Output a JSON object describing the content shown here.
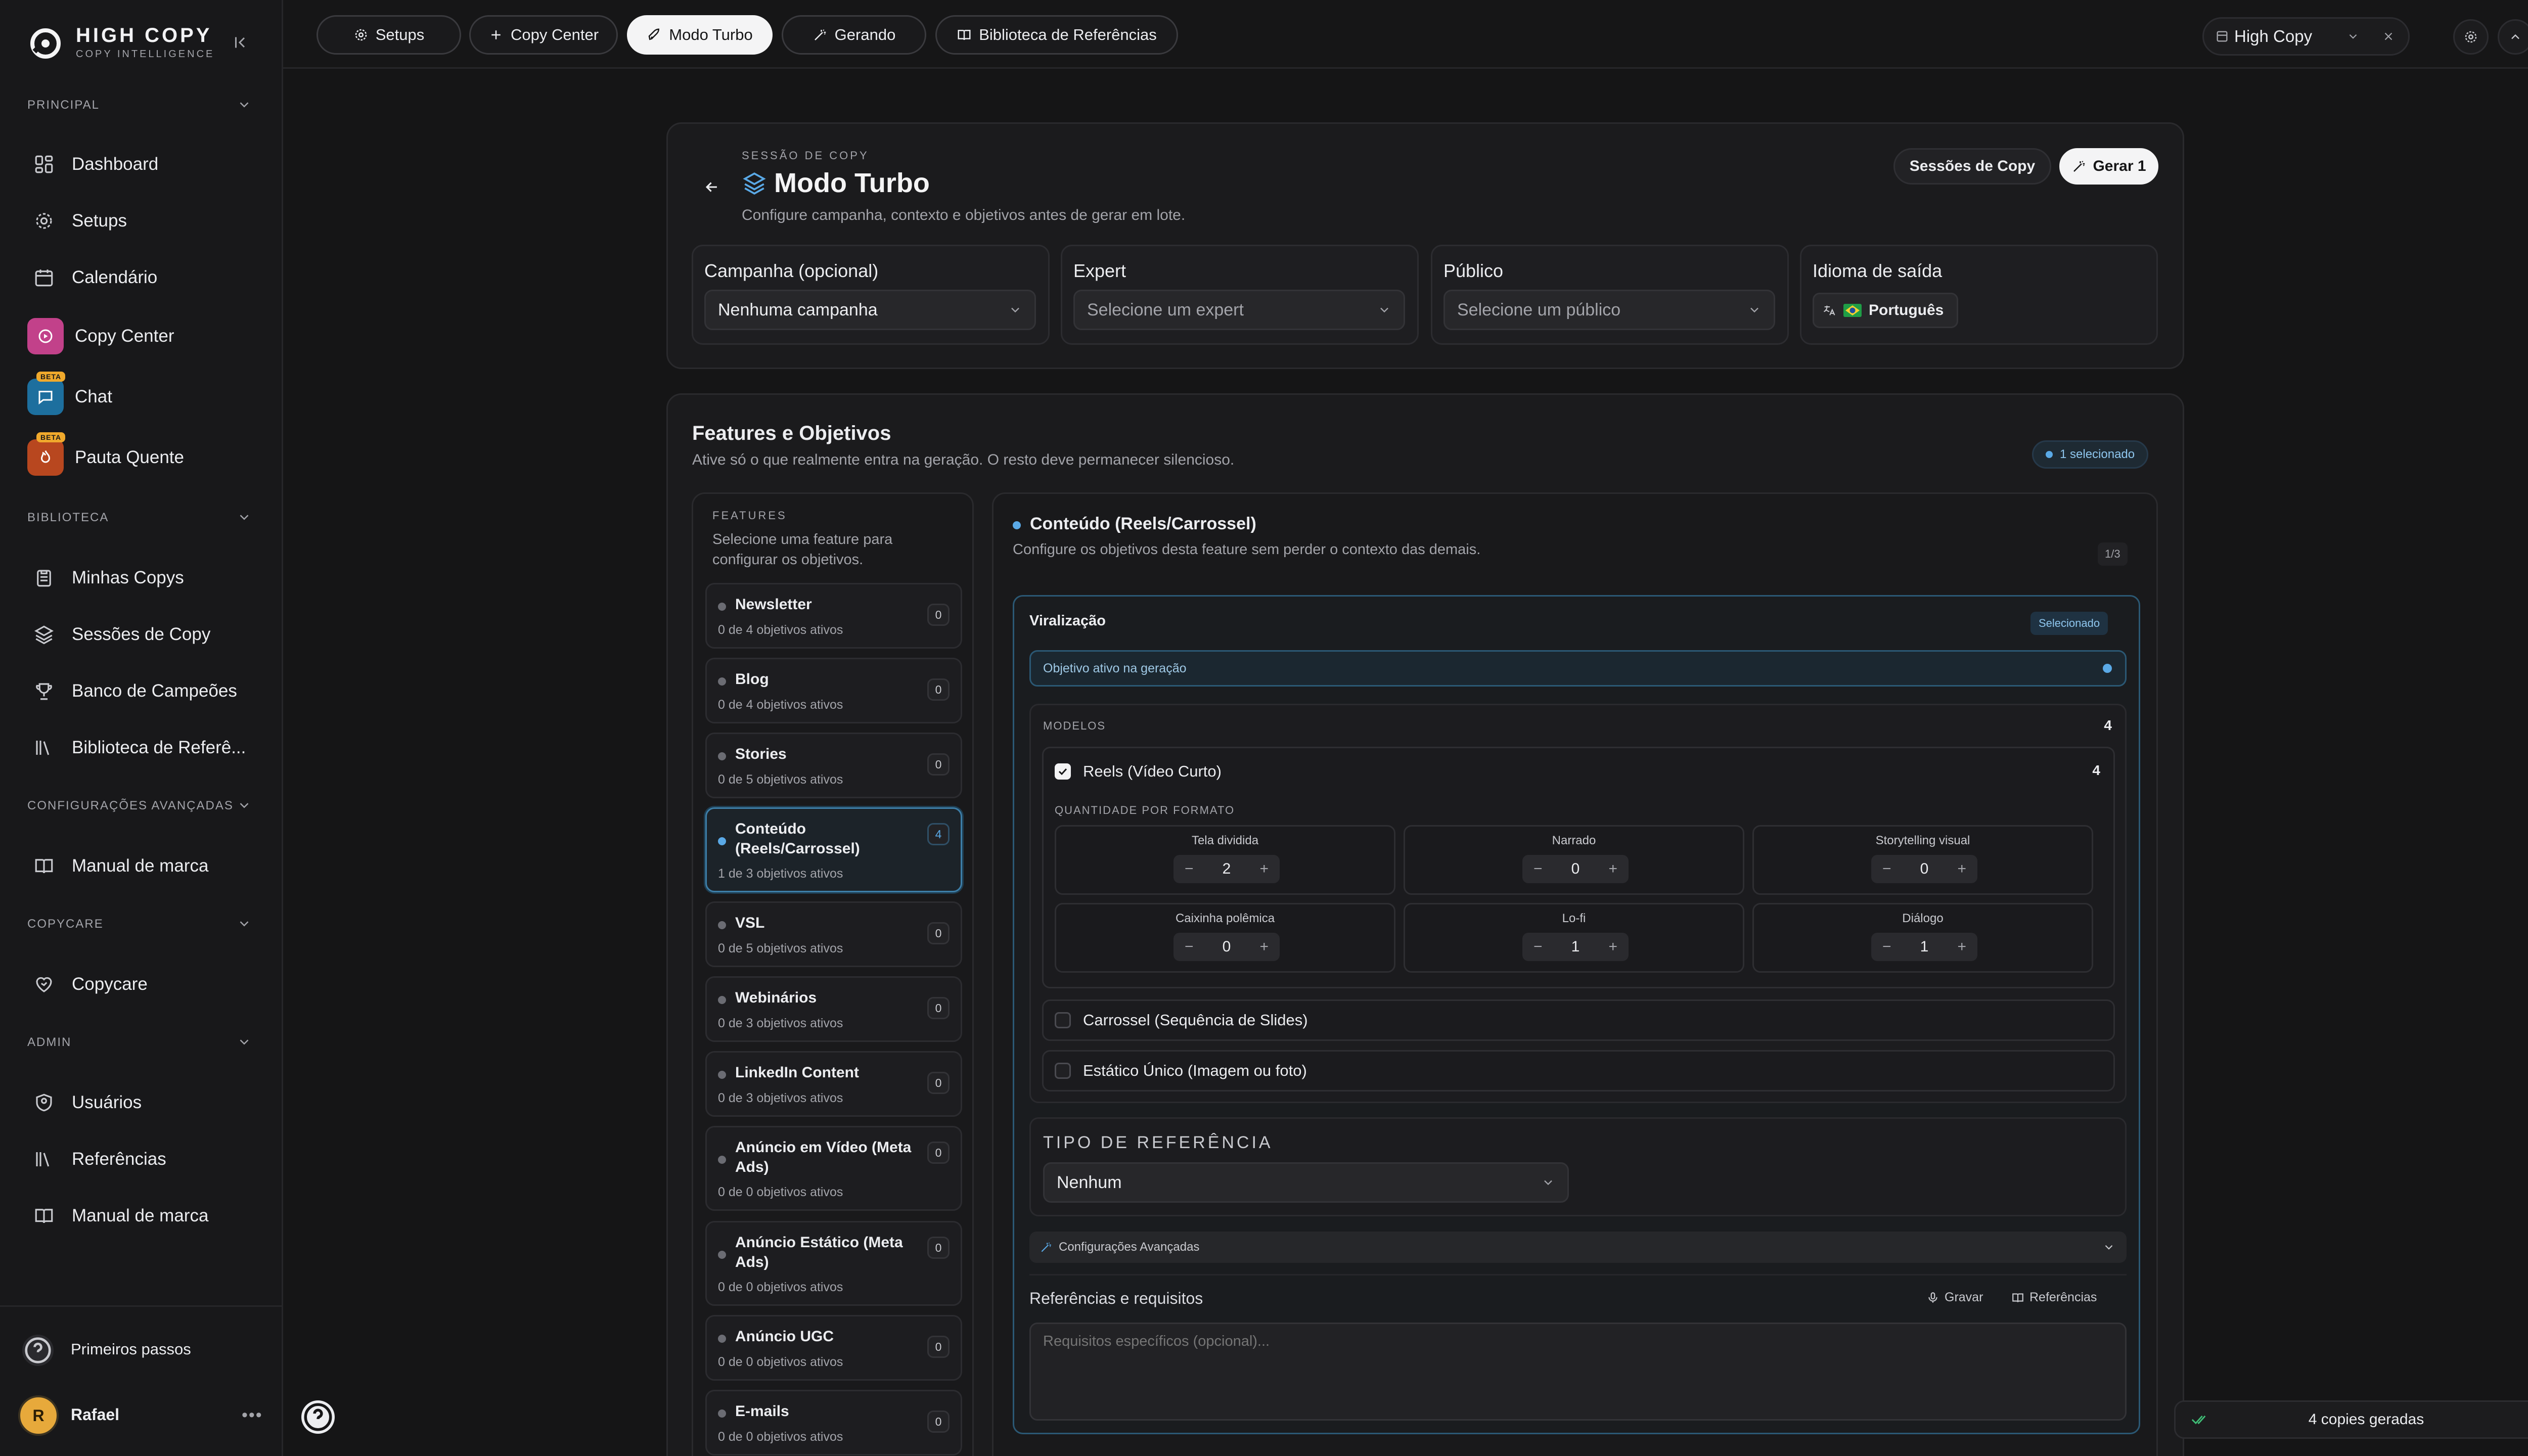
{
  "brand": {
    "name": "HIGH COPY",
    "tagline": "COPY INTELLIGENCE"
  },
  "sidebar": {
    "sections": [
      {
        "label": "PRINCIPAL"
      },
      {
        "label": "BIBLIOTECA"
      },
      {
        "label": "CONFIGURAÇÕES AVANÇADAS"
      },
      {
        "label": "COPYCARE"
      },
      {
        "label": "ADMIN"
      }
    ],
    "items": {
      "dashboard": "Dashboard",
      "setups": "Setups",
      "calendario": "Calendário",
      "copy_center": "Copy Center",
      "chat": "Chat",
      "pauta_quente": "Pauta Quente",
      "minhas_copys": "Minhas Copys",
      "sessoes": "Sessões de Copy",
      "banco": "Banco de Campeões",
      "biblioteca": "Biblioteca de Referê...",
      "manual1": "Manual de marca",
      "copycare": "Copycare",
      "usuarios": "Usuários",
      "referencias": "Referências",
      "manual2": "Manual de marca"
    },
    "beta_label": "BETA",
    "footer": {
      "help": "Primeiros passos",
      "user_initial": "R",
      "user_name": "Rafael"
    }
  },
  "topbar": {
    "tabs": [
      "Setups",
      "Copy Center",
      "Modo Turbo",
      "Gerando",
      "Biblioteca de Referências"
    ],
    "active_tab": "Modo Turbo",
    "org_name": "High Copy"
  },
  "session": {
    "eyebrow": "SESSÃO DE COPY",
    "title": "Modo Turbo",
    "subtitle": "Configure campanha, contexto e objetivos antes de gerar em lote.",
    "btn_sessions": "Sessões de Copy",
    "btn_generate": "Gerar 1",
    "fields": {
      "campaign": {
        "label": "Campanha (opcional)",
        "value": "Nenhuma campanha"
      },
      "expert": {
        "label": "Expert",
        "value": "Selecione um expert"
      },
      "audience": {
        "label": "Público",
        "value": "Selecione um público"
      },
      "language": {
        "label": "Idioma de saída",
        "value": "Português"
      }
    }
  },
  "features": {
    "title": "Features e Objetivos",
    "subtitle": "Ative só o que realmente entra na geração. O resto deve permanecer silencioso.",
    "selected_badge": "1 selecionado",
    "list_eyebrow": "FEATURES",
    "list_hint": "Selecione uma feature para configurar os objetivos.",
    "items": [
      {
        "name": "Newsletter",
        "sub": "0 de 4 objetivos ativos",
        "count": "0"
      },
      {
        "name": "Blog",
        "sub": "0 de 4 objetivos ativos",
        "count": "0"
      },
      {
        "name": "Stories",
        "sub": "0 de 5 objetivos ativos",
        "count": "0"
      },
      {
        "name": "Conteúdo (Reels/Carrossel)",
        "sub": "1 de 3 objetivos ativos",
        "count": "4"
      },
      {
        "name": "VSL",
        "sub": "0 de 5 objetivos ativos",
        "count": "0"
      },
      {
        "name": "Webinários",
        "sub": "0 de 3 objetivos ativos",
        "count": "0"
      },
      {
        "name": "LinkedIn Content",
        "sub": "0 de 3 objetivos ativos",
        "count": "0"
      },
      {
        "name": "Anúncio em Vídeo (Meta Ads)",
        "sub": "0 de 0 objetivos ativos",
        "count": "0"
      },
      {
        "name": "Anúncio Estático (Meta Ads)",
        "sub": "0 de 0 objetivos ativos",
        "count": "0"
      },
      {
        "name": "Anúncio UGC",
        "sub": "0 de 0 objetivos ativos",
        "count": "0"
      },
      {
        "name": "E-mails",
        "sub": "0 de 0 objetivos ativos",
        "count": "0"
      }
    ]
  },
  "detail": {
    "title": "Conteúdo (Reels/Carrossel)",
    "subtitle": "Configure os objetivos desta feature sem perder o contexto das demais.",
    "pager": "1/3",
    "objective": {
      "name": "Viralização",
      "badge": "Selecionado",
      "active_label": "Objetivo ativo na geração"
    },
    "models_label": "MODELOS",
    "models_count": "4",
    "reels": {
      "label": "Reels (Vídeo Curto)",
      "count": "4"
    },
    "qty_label": "QUANTIDADE POR FORMATO",
    "formats": [
      {
        "name": "Tela dividida",
        "value": "2"
      },
      {
        "name": "Narrado",
        "value": "0"
      },
      {
        "name": "Storytelling visual",
        "value": "0"
      },
      {
        "name": "Caixinha polêmica",
        "value": "0"
      },
      {
        "name": "Lo-fi",
        "value": "1"
      },
      {
        "name": "Diálogo",
        "value": "1"
      }
    ],
    "carrossel": "Carrossel (Sequência de Slides)",
    "estatico": "Estático Único (Imagem ou foto)",
    "ref_type_label": "TIPO DE REFERÊNCIA",
    "ref_type_value": "Nenhum",
    "advanced": "Configurações Avançadas",
    "refs_title": "Referências e requisitos",
    "record": "Gravar",
    "refs_btn": "Referências",
    "requirements_placeholder": "Requisitos específicos (opcional)..."
  },
  "toast": {
    "label": "4 copies geradas"
  },
  "colors": {
    "accent_blue": "#5aa9e6",
    "brand_gold": "#f0a92c",
    "copy_center": "#c2418a",
    "chat": "#1d6f9e",
    "pauta": "#b8471f"
  }
}
